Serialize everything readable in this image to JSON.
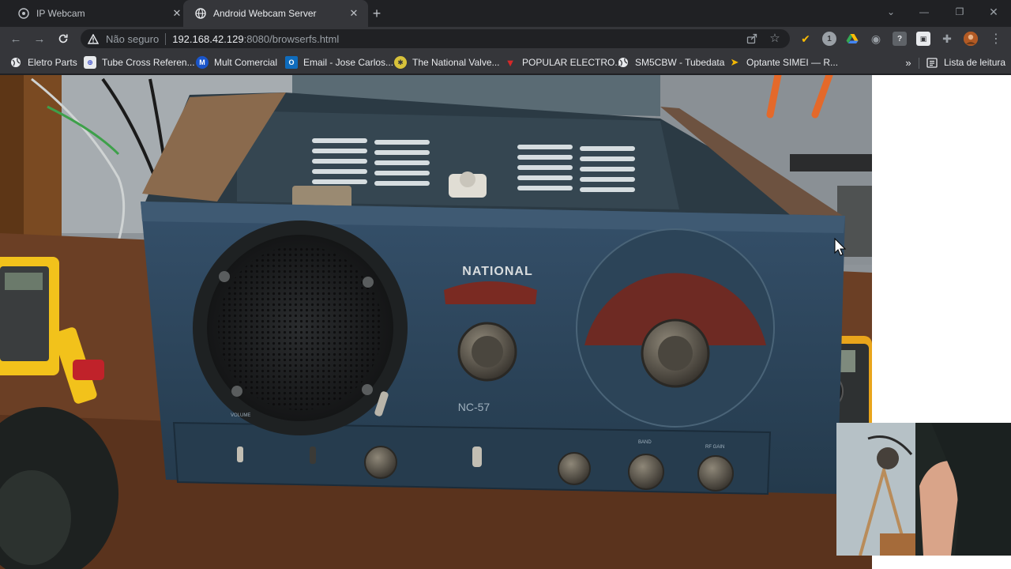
{
  "browser": {
    "tabs": [
      {
        "title": "IP Webcam",
        "active": false
      },
      {
        "title": "Android Webcam Server",
        "active": true
      }
    ],
    "address": {
      "security_label": "Não seguro",
      "host": "192.168.42.129",
      "rest": ":8080/browserfs.html"
    }
  },
  "bookmarks": {
    "items": [
      {
        "label": "Eletro Parts",
        "icon": "globe-icon"
      },
      {
        "label": "Tube Cross Referen...",
        "icon": "tube-cross-icon"
      },
      {
        "label": "Mult Comercial",
        "icon": "mult-comercial-icon"
      },
      {
        "label": "Email - Jose Carlos...",
        "icon": "outlook-icon"
      },
      {
        "label": "The National Valve...",
        "icon": "national-valve-icon"
      },
      {
        "label": "POPULAR ELECTRO...",
        "icon": "popular-electro-icon"
      },
      {
        "label": "SM5CBW - Tubedata",
        "icon": "globe-icon"
      },
      {
        "label": "Optante SIMEI — R...",
        "icon": "simei-icon"
      }
    ],
    "reading_list": "Lista de leitura"
  },
  "radio": {
    "brand": "NATIONAL",
    "model": "NC-57",
    "labels": [
      "VOLUME",
      "BAND",
      "RF GAIN"
    ]
  },
  "colors": {
    "chrome_dark": "#202124",
    "chrome_toolbar": "#35363a",
    "radio_body": "#2f4658",
    "radio_dial": "#6e2a23"
  }
}
